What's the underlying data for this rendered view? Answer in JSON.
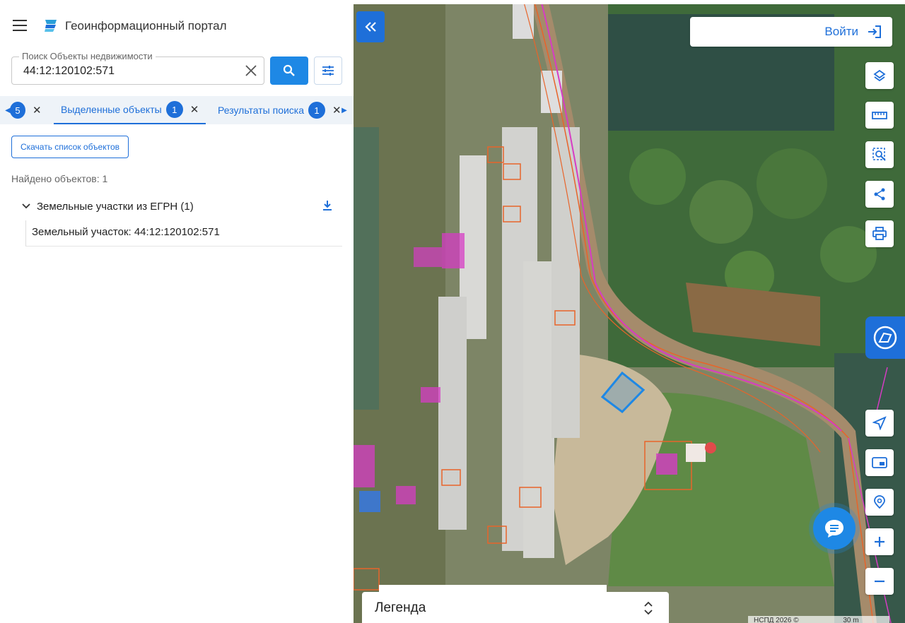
{
  "app": {
    "title": "Геоинформационный портал"
  },
  "search": {
    "label": "Поиск Объекты недвижимости",
    "value": "44:12:120102:571"
  },
  "tabs": {
    "first_badge": "5",
    "selected": {
      "label": "Выделенные объекты",
      "badge": "1"
    },
    "results": {
      "label": "Результаты поиска",
      "badge": "1"
    }
  },
  "results": {
    "download_list_label": "Скачать список объектов",
    "found_label": "Найдено объектов: 1",
    "group_title": "Земельные участки из ЕГРН (1)",
    "item_label": "Земельный участок: 44:12:120102:571"
  },
  "map": {
    "login_label": "Войти",
    "legend_label": "Легенда",
    "attribution": "НСПД 2026 ©",
    "scale": "30 m"
  },
  "colors": {
    "accent": "#1e6fd9",
    "button_blue": "#1e88e5",
    "tab_bar_bg": "#eef3f8",
    "selection_outline": "#1e88e5",
    "parcel_pink": "#d63cc4",
    "parcel_orange": "#e8642a"
  },
  "icons": {
    "menu": "hamburger-icon",
    "logo": "portal-logo-icon",
    "clear": "close-icon",
    "search": "search-icon",
    "filter": "filter-sliders-icon",
    "collapse": "double-chevron-left-icon",
    "login": "login-icon",
    "layers": "layers-icon",
    "ruler": "ruler-icon",
    "select_area": "area-search-icon",
    "share": "share-icon",
    "print": "printer-icon",
    "side_panel": "map-panel-icon",
    "locate": "navigation-arrow-icon",
    "picture_in_picture": "minimap-icon",
    "geolocation_search": "location-search-icon",
    "zoom_in": "plus-icon",
    "zoom_out": "minus-icon",
    "chat": "chat-icon",
    "legend_toggle": "chevron-up-down-icon"
  }
}
